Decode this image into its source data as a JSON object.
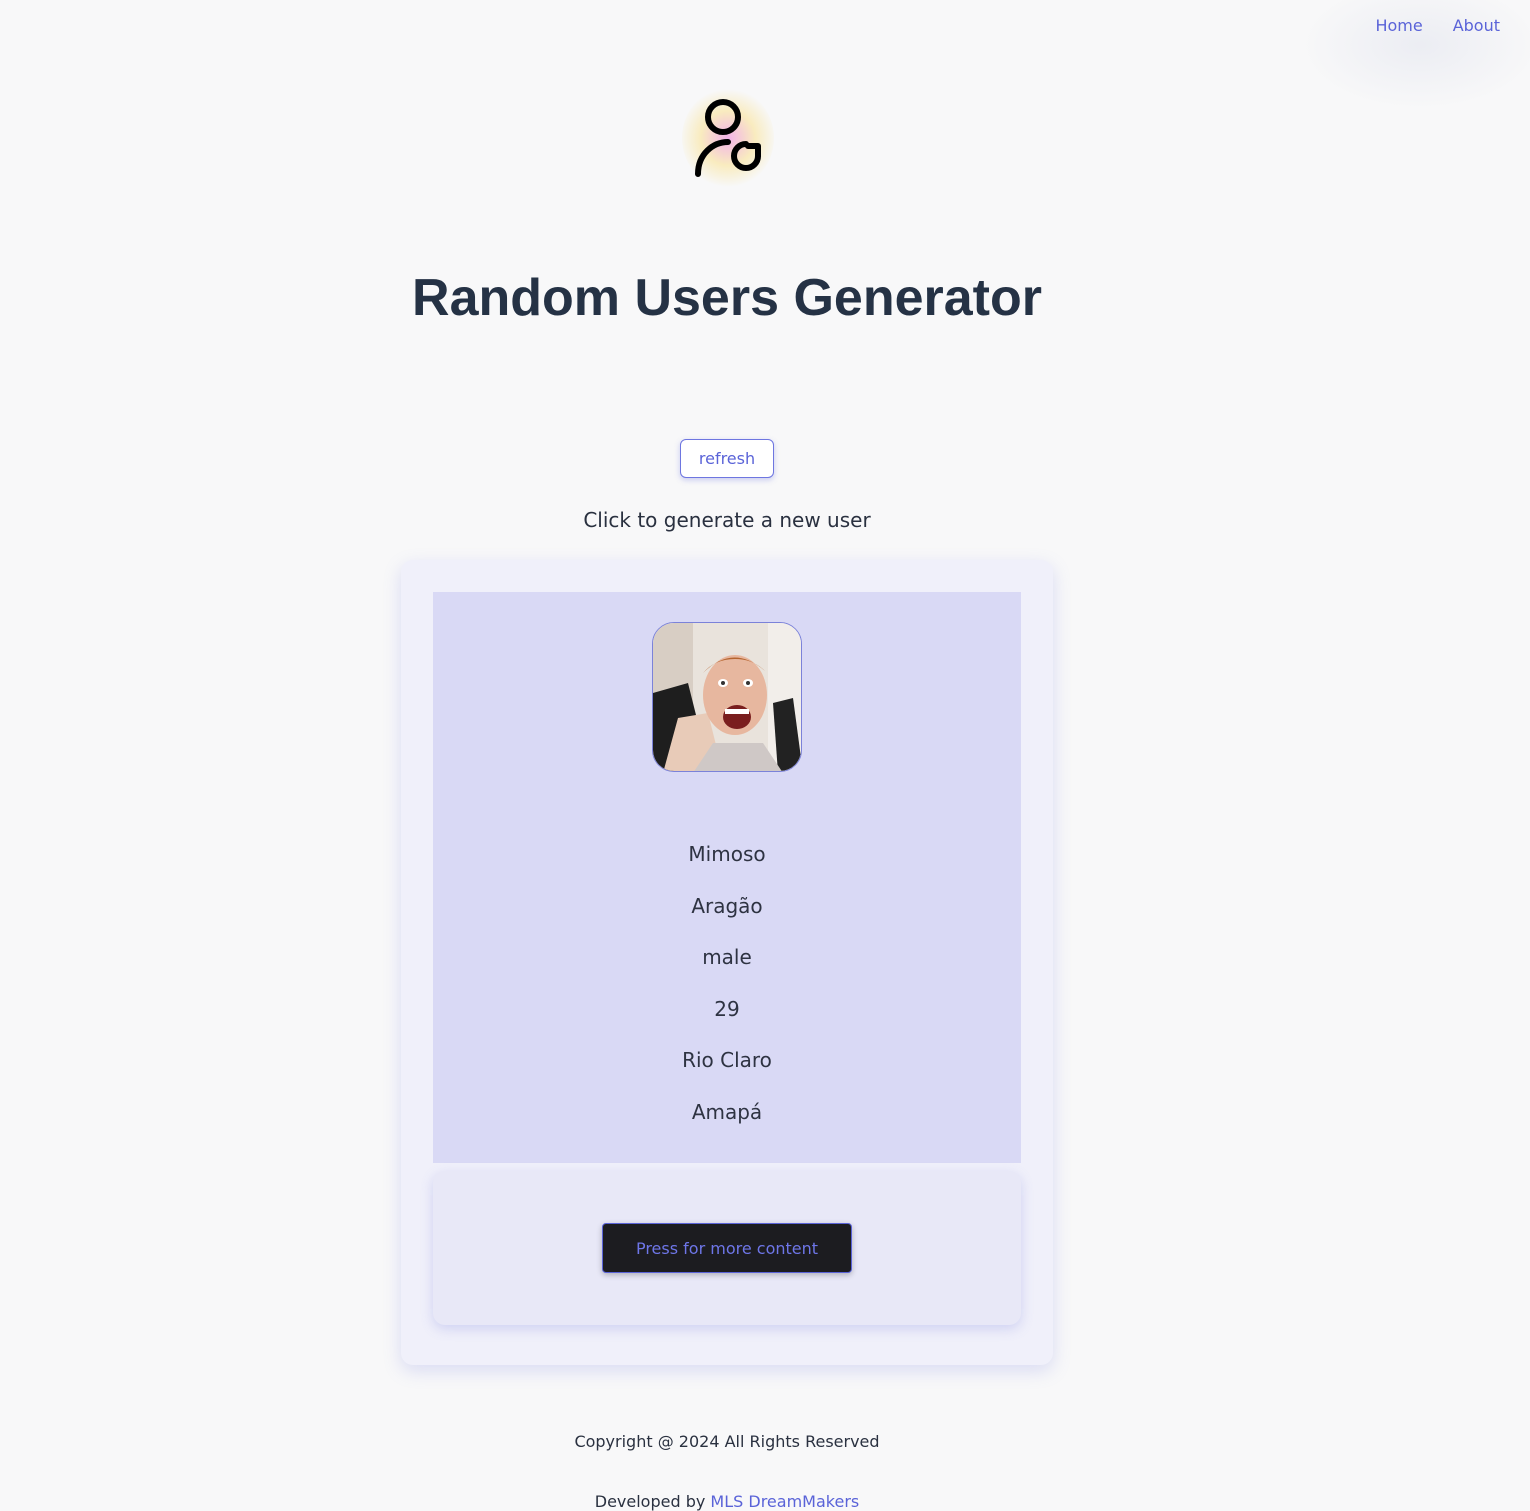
{
  "nav": {
    "home_label": "Home",
    "about_label": "About"
  },
  "header": {
    "logo_icon": "user-refresh-icon",
    "title": "Random Users Generator"
  },
  "controls": {
    "refresh_label": "refresh",
    "hint": "Click to generate a new user"
  },
  "user": {
    "avatar_icon": "user-photo",
    "first_name": "Mimoso",
    "last_name": "Aragão",
    "gender": "male",
    "age": "29",
    "city": "Rio Claro",
    "state": "Amapá"
  },
  "card_footer": {
    "more_label": "Press for more content"
  },
  "footer": {
    "copyright": "Copyright @ 2024 All Rights Reserved",
    "developed_prefix": "Developed by",
    "developer_link": "MLS DreamMakers"
  },
  "colors": {
    "accent": "#5a63d8",
    "card_bg": "#f0f0fa",
    "card_body_bg": "#d9d9f5",
    "title_color": "#253245"
  }
}
